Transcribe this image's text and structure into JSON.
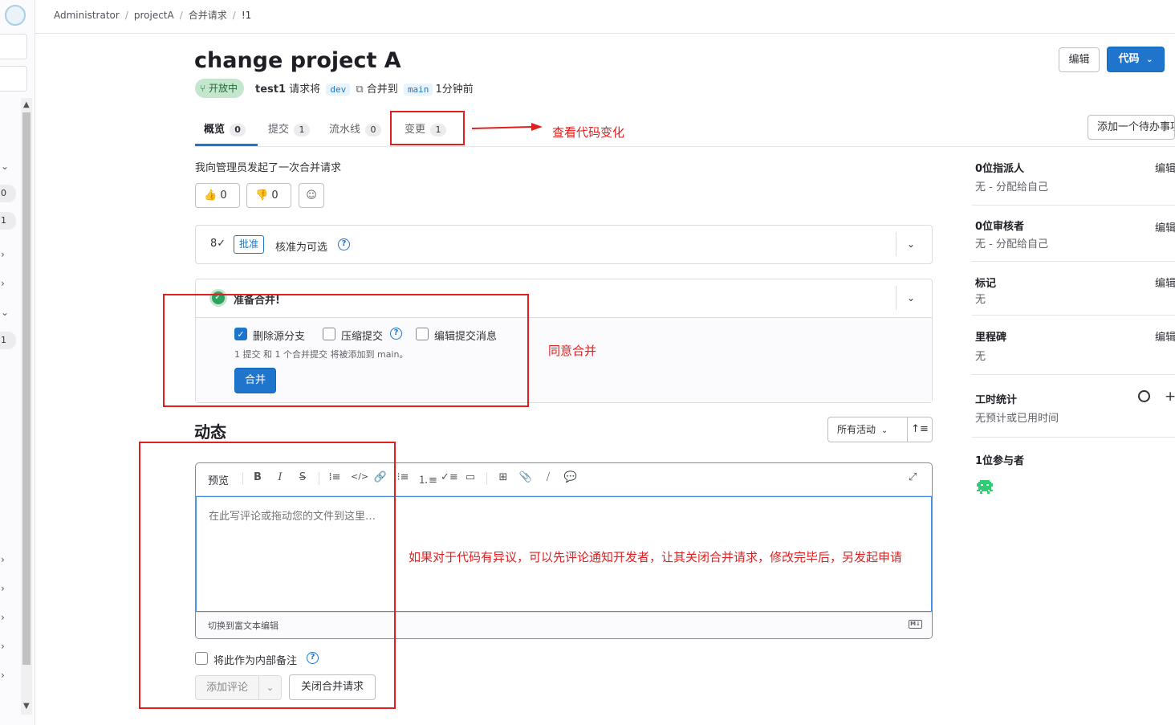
{
  "breadcrumb": [
    "Administrator",
    "projectA",
    "合并请求",
    "!1"
  ],
  "mr": {
    "title": "change project A",
    "status": "开放中",
    "author": "test1",
    "request_text": "请求将",
    "source_branch": "dev",
    "merge_into_text": "合并到",
    "target_branch": "main",
    "time": "1分钟前"
  },
  "header_buttons": {
    "edit": "编辑",
    "code": "代码"
  },
  "tabs": [
    {
      "label": "概览",
      "count": "0"
    },
    {
      "label": "提交",
      "count": "1"
    },
    {
      "label": "流水线",
      "count": "0"
    },
    {
      "label": "变更",
      "count": "1"
    }
  ],
  "todo_button": "添加一个待办事项",
  "description": "我向管理员发起了一次合并请求",
  "reactions": {
    "thumbs_up": "0",
    "thumbs_down": "0"
  },
  "approval": {
    "chip": "批准",
    "text": "核准为可选"
  },
  "merge": {
    "ready": "准备合并!",
    "delete_source": "删除源分支",
    "squash": "压缩提交",
    "edit_message": "编辑提交消息",
    "note": "1 提交 和 1 个合并提交 将被添加到 main。",
    "button": "合并"
  },
  "activity": {
    "title": "动态",
    "filter": "所有活动",
    "editor_preview": "预览",
    "placeholder": "在此写评论或拖动您的文件到这里…",
    "rich_text_toggle": "切换到富文本编辑",
    "internal_note": "将此作为内部备注",
    "add_comment": "添加评论",
    "close_mr": "关闭合并请求"
  },
  "sidebar_right": {
    "assignee_title": "0位指派人",
    "assignee_value": "无 - 分配给自己",
    "reviewer_title": "0位审核者",
    "reviewer_value": "无 - 分配给自己",
    "labels_title": "标记",
    "labels_value": "无",
    "milestone_title": "里程碑",
    "milestone_value": "无",
    "time_title": "工时统计",
    "time_value": "无预计或已用时间",
    "participants_title": "1位参与者",
    "edit": "编辑"
  },
  "left_sidebar_counts": [
    "0",
    "1",
    "1"
  ],
  "annotations": {
    "changes": "查看代码变化",
    "merge": "同意合并",
    "comment": "如果对于代码有异议，可以先评论通知开发者，让其关闭合并请求，修改完毕后，另发起申请"
  },
  "colors": {
    "accent": "#1f75cb",
    "status_open_bg": "#c3e6cd",
    "status_open_text": "#24663b",
    "annotation": "#e02020",
    "success": "#2da160"
  },
  "icons": [
    "tanuki-logo-icon",
    "merge-request-icon",
    "copy-icon",
    "thumbs-up-icon",
    "thumbs-down-icon",
    "emoji-icon",
    "approval-user-icon",
    "help-icon",
    "chevron-down-icon",
    "check-circle-icon",
    "sort-icon",
    "bold-icon",
    "italic-icon",
    "strikethrough-icon",
    "quote-icon",
    "code-icon",
    "link-icon",
    "bullet-list-icon",
    "numbered-list-icon",
    "task-list-icon",
    "collapsible-icon",
    "table-icon",
    "attach-icon",
    "quick-action-icon",
    "comment-template-icon",
    "expand-icon",
    "markdown-icon",
    "timer-icon",
    "plus-icon"
  ]
}
